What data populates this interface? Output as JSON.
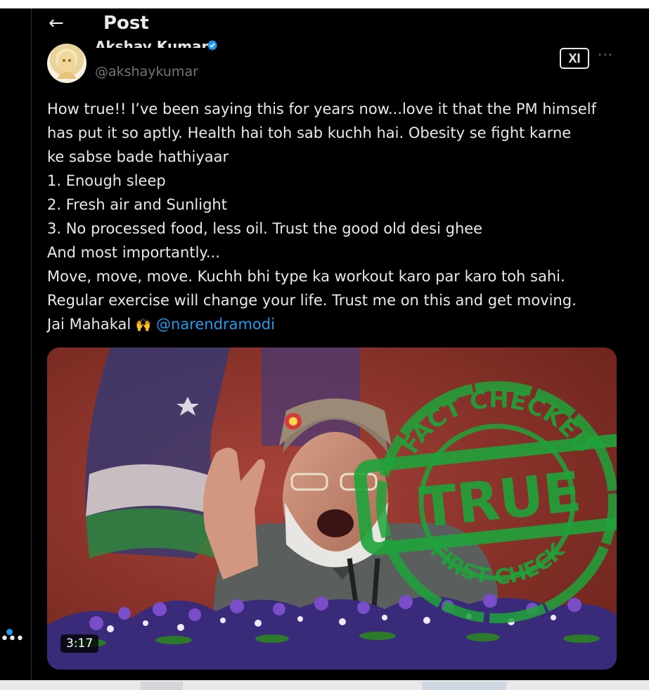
{
  "header": {
    "title": "Post"
  },
  "author": {
    "name": "Akshay Kumar",
    "handle": "@akshaykumar",
    "grok_label": "XI"
  },
  "tweet": {
    "lines": [
      "How true!! I’ve been saying this for years now...love it that the PM himself",
      "has put it so aptly. Health hai toh sab kuchh hai. Obesity se fight karne",
      "ke sabse bade hathiyaar",
      "1. Enough sleep",
      "2. Fresh air and Sunlight",
      "3. No processed food, less oil. Trust the good old desi ghee",
      "And most importantly...",
      "Move, move, move. Kuchh bhi type ka workout karo par karo toh sahi.",
      "Regular exercise will change your life. Trust me on this and get moving."
    ],
    "last_line_text": "Jai Mahakal",
    "last_line_emoji": "🙌",
    "mention": "@narendramodi"
  },
  "media": {
    "duration": "3:17",
    "stamp": {
      "top_text": "FACT CHECKED",
      "center_text": "TRUE",
      "bottom_text": "FIRST CHECK",
      "color": "#1fa33a"
    }
  },
  "colors": {
    "background": "#000000",
    "text": "#e7e9ea",
    "secondary": "#71767b",
    "accent": "#1d9bf0"
  },
  "icons": [
    "back-arrow-icon",
    "verified-badge-icon",
    "grok-icon",
    "more-options-icon",
    "more-nav-icon"
  ]
}
